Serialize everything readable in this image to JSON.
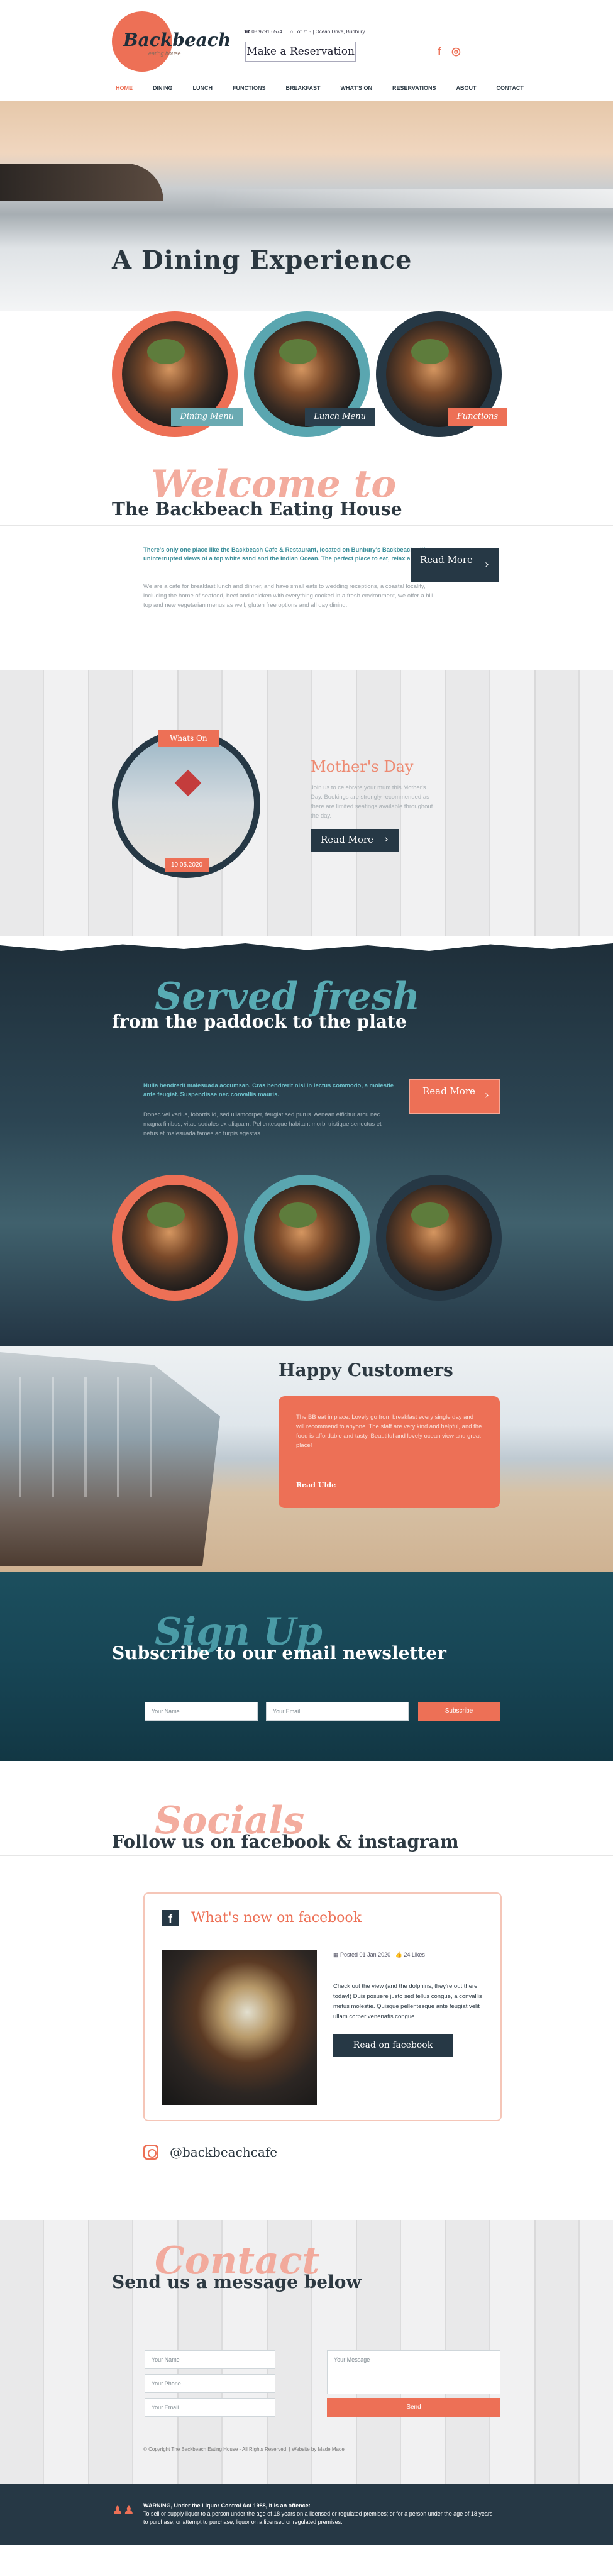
{
  "header": {
    "logo_text": "Backbeach",
    "logo_sub": "eating house",
    "phone": "☎ 08 9791 6574",
    "address": "⌂ Lot 715 | Ocean Drive, Bunbury",
    "reserve_label": "Make a Reservation",
    "facebook_icon": "f",
    "instagram_icon": "◎",
    "nav": [
      "HOME",
      "DINING",
      "LUNCH",
      "FUNCTIONS",
      "BREAKFAST",
      "WHAT'S ON",
      "RESERVATIONS",
      "ABOUT",
      "CONTACT"
    ]
  },
  "hero": {
    "title": "A Dining Experience"
  },
  "dishes": [
    {
      "label": "Dining Menu",
      "ring": "#ed7056",
      "tag": "#6aaab2"
    },
    {
      "label": "Lunch Menu",
      "ring": "#5aa6b0",
      "tag": "#2a3f4d"
    },
    {
      "label": "Functions",
      "ring": "#263845",
      "tag": "#ed7056"
    }
  ],
  "welcome": {
    "script": "Welcome to",
    "subtitle": "The Backbeach Eating House",
    "lead": "There's only one place like the Backbeach Cafe & Restaurant, located on Bunbury's Backbeach with uninterrupted views of a top white sand and the Indian Ocean. The perfect place to eat, relax and enjoy.",
    "body": "We are a cafe for breakfast lunch and dinner, and have small eats to wedding receptions, a coastal locality, including the home of seafood, beef and chicken with everything cooked in a fresh environment, we offer a hill top and new vegetarian menus as well, gluten free options and all day dining.",
    "read_more": "Read More"
  },
  "mothers_day": {
    "tag": "Whats On",
    "date": "10.05.2020",
    "title": "Mother's Day",
    "desc": "Join us to celebrate your mum this Mother's Day. Bookings are strongly recommended as there are limited seatings available throughout the day.",
    "read_more": "Read More"
  },
  "fresh": {
    "script": "Served fresh",
    "subtitle": "from the paddock to the plate",
    "lead": "Nulla hendrerit malesuada accumsan. Cras hendrerit nisl in lectus commodo, a molestie ante feugiat. Suspendisse nec convallis mauris.",
    "body": "Donec vel varius, lobortis id, sed ullamcorper, feugiat sed purus. Aenean efficitur arcu nec magna finibus, vitae sodales ex aliquam. Pellentesque habitant morbi tristique senectus et netus et malesuada fames ac turpis egestas.",
    "read_more": "Read More"
  },
  "happy": {
    "title": "Happy Customers",
    "quote": "The BB eat in place. Lovely go from breakfast every single day and will recommend to anyone. The staff are very kind and helpful, and the food is affordable and tasty. Beautiful and lovely ocean view and great place!",
    "read": "Read Ulde"
  },
  "signup": {
    "script": "Sign Up",
    "subtitle": "Subscribe to our email newsletter",
    "name_placeholder": "Your Name",
    "email_placeholder": "Your Email",
    "button": "Subscribe"
  },
  "socials": {
    "script": "Socials",
    "subtitle": "Follow us on facebook & instagram",
    "fb_title": "What's new on facebook",
    "posted": "Posted 01 Jan 2020",
    "likes": "24 Likes",
    "post": "Check out the view (and the dolphins, they're out there today!) Duis posuere justo sed tellus congue, a convallis metus molestie. Quisque pellentesque ante feugiat velit ullam corper venenatis congue.",
    "fb_button": "Read on facebook",
    "ig_handle": "@backbeachcafe"
  },
  "contact": {
    "script": "Contact",
    "subtitle": "Send us a message below",
    "name_placeholder": "Your Name",
    "phone_placeholder": "Your Phone",
    "email_placeholder": "Your Email",
    "message_placeholder": "Your Message",
    "send": "Send",
    "copyright": "© Copyright The Backbeach Eating House - All Rights Reserved. | Website by Made Made"
  },
  "warning": {
    "line1": "WARNING, Under the Liquor Control Act 1988, it is an offence:",
    "line2": "To sell or supply liquor to a person under the age of 18 years on a licensed or regulated premises; or for a person under the age of 18 years to purchase, or attempt to purchase, liquor on a licensed or regulated premises."
  },
  "colors": {
    "coral": "#ed7056",
    "navy": "#263845",
    "teal": "#5aa6b0"
  }
}
